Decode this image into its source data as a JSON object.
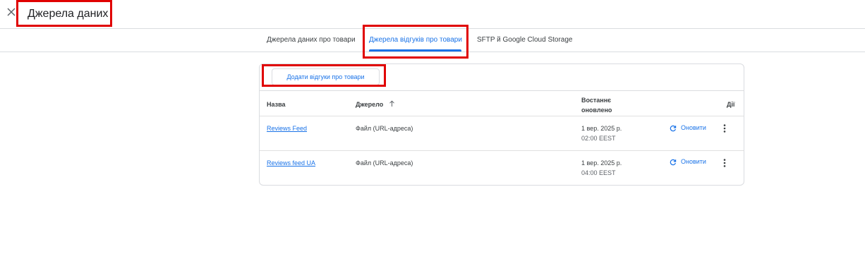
{
  "header": {
    "title": "Джерела даних",
    "close_icon": "close-icon"
  },
  "tabs": [
    {
      "label": "Джерела даних про товари",
      "active": false
    },
    {
      "label": "Джерела відгуків про товари",
      "active": true
    },
    {
      "label": "SFTP й Google Cloud Storage",
      "active": false
    }
  ],
  "toolbar": {
    "add_label": "Додати відгуки про товари"
  },
  "table": {
    "headers": {
      "name": "Назва",
      "source": "Джерело",
      "updated": "Востаннє оновлено",
      "actions": "Дії"
    },
    "rows": [
      {
        "name": "Reviews Feed",
        "source": "Файл (URL-адреса)",
        "date": "1 вер. 2025 р.",
        "time": "02:00 EEST",
        "refresh_label": "Оновити"
      },
      {
        "name": "Reviews feed UA",
        "source": "Файл (URL-адреса)",
        "date": "1 вер. 2025 р.",
        "time": "04:00 EEST",
        "refresh_label": "Оновити"
      }
    ]
  },
  "colors": {
    "accent": "#1a73e8",
    "highlight": "#e00000",
    "divider": "#dadce0"
  }
}
